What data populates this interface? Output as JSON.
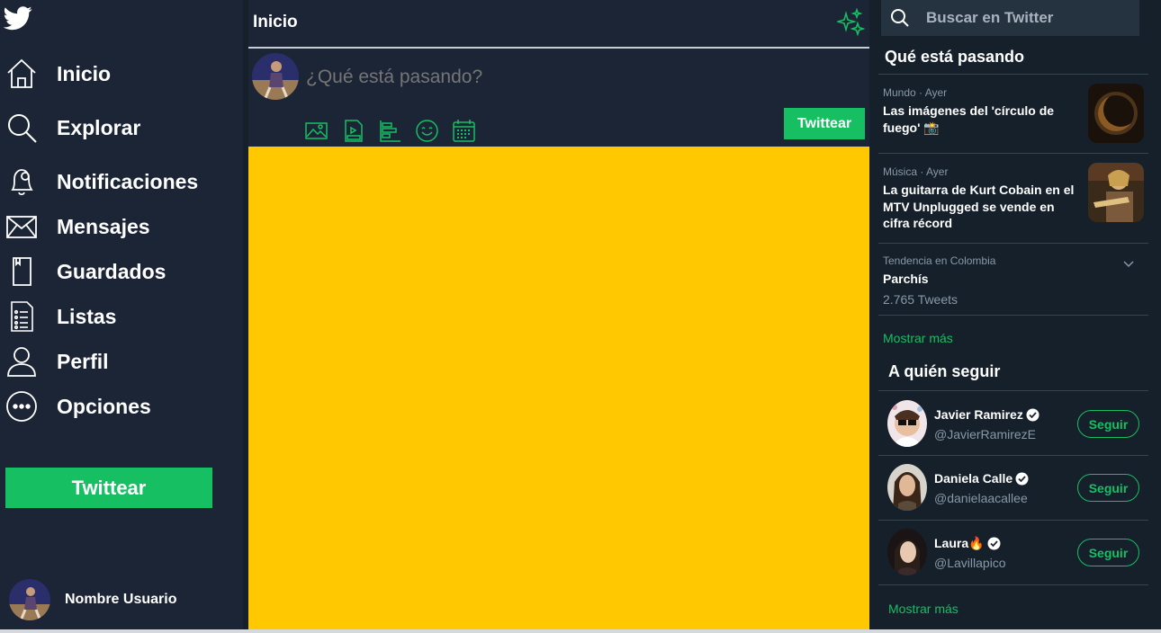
{
  "sidebar": {
    "items": [
      {
        "label": "Inicio",
        "icon": "home-icon"
      },
      {
        "label": "Explorar",
        "icon": "search-icon"
      },
      {
        "label": "Notificaciones",
        "icon": "bell-icon"
      },
      {
        "label": "Mensajes",
        "icon": "mail-icon"
      },
      {
        "label": "Guardados",
        "icon": "bookmark-icon"
      },
      {
        "label": "Listas",
        "icon": "list-icon"
      },
      {
        "label": "Perfil",
        "icon": "user-icon"
      },
      {
        "label": "Opciones",
        "icon": "more-icon"
      }
    ],
    "tweet_button": "Twittear",
    "user_name": "Nombre Usuario"
  },
  "main": {
    "title": "Inicio",
    "compose_placeholder": "¿Qué está pasando?",
    "tweet_button": "Twittear"
  },
  "right": {
    "search_placeholder": "Buscar en Twitter",
    "trends_title": "Qué está pasando",
    "trends": [
      {
        "meta": "Mundo · Ayer",
        "title": "Las imágenes del 'círculo de fuego' 📸"
      },
      {
        "meta": "Música · Ayer",
        "title": "La guitarra de Kurt Cobain en el MTV Unplugged se vende en cifra récord"
      },
      {
        "meta": "Tendencia en Colombia",
        "title": "Parchís",
        "count": "2.765 Tweets"
      }
    ],
    "show_more": "Mostrar más",
    "who_to_follow_title": "A quién seguir",
    "follow": [
      {
        "name": "Javier Ramirez",
        "handle": "@JavierRamirezE",
        "button": "Seguir"
      },
      {
        "name": "Daniela Calle",
        "handle": "@danielaacallee",
        "button": "Seguir"
      },
      {
        "name": "Laura🔥",
        "handle": "@Lavillapico",
        "button": "Seguir"
      }
    ],
    "show_more_2": "Mostrar más"
  },
  "colors": {
    "background": "#1b2535",
    "accent": "#17bf63",
    "feed": "#ffc800"
  }
}
